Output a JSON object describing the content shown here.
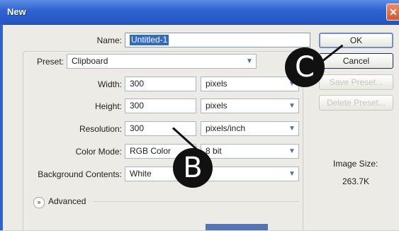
{
  "dialog": {
    "title": "New",
    "close_icon": "close-icon"
  },
  "fields": {
    "name_label": "Name:",
    "name_value": "Untitled-1",
    "preset_label": "Preset:",
    "preset_value": "Clipboard",
    "width_label": "Width:",
    "width_value": "300",
    "width_unit": "pixels",
    "height_label": "Height:",
    "height_value": "300",
    "height_unit": "pixels",
    "resolution_label": "Resolution:",
    "resolution_value": "300",
    "resolution_unit": "pixels/inch",
    "color_mode_label": "Color Mode:",
    "color_mode_value": "RGB Color",
    "bit_depth_value": "8 bit",
    "background_label": "Background Contents:",
    "background_value": "White",
    "advanced_label": "Advanced"
  },
  "buttons": {
    "ok": "OK",
    "cancel": "Cancel",
    "save_preset": "Save Preset...",
    "delete_preset": "Delete Preset..."
  },
  "image_size": {
    "label": "Image Size:",
    "value": "263.7K"
  },
  "markers": {
    "c": "C",
    "b": "B"
  }
}
